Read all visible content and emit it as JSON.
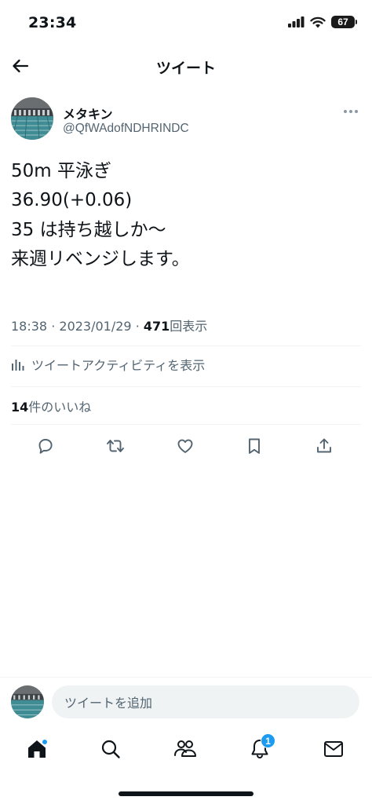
{
  "status_bar": {
    "time": "23:34",
    "battery": "67"
  },
  "header": {
    "title": "ツイート"
  },
  "author": {
    "name": "メタキン",
    "handle": "@QfWAdofNDHRINDC"
  },
  "tweet": {
    "text": "50m 平泳ぎ\n36.90(+0.06)\n35 は持ち越しか〜\n来週リベンジします。"
  },
  "meta": {
    "time": "18:38",
    "separator": "·",
    "date": "2023/01/29",
    "views_count": "471",
    "views_label": "回表示"
  },
  "activity": {
    "label": "ツイートアクティビティを表示"
  },
  "likes": {
    "count": "14",
    "label": "件のいいね"
  },
  "reply": {
    "placeholder": "ツイートを追加"
  },
  "tab_bar": {
    "notifications_badge": "1"
  },
  "colors": {
    "accent": "#1d9bf0",
    "text": "#0f1419",
    "secondary": "#536471",
    "divider": "#eff3f4"
  }
}
